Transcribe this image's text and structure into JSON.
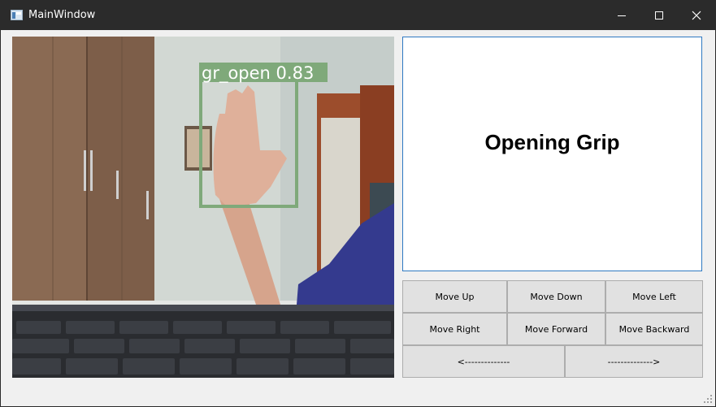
{
  "window": {
    "title": "MainWindow",
    "controls": {
      "minimize_icon": "minimize-icon",
      "maximize_icon": "maximize-icon",
      "close_icon": "close-icon"
    }
  },
  "camera_feed": {
    "detection_label": "gr_open 0.83",
    "detection_box_color": "#7fa97a"
  },
  "status_panel": {
    "text": "Opening Grip",
    "border_color": "#2f79c2"
  },
  "controls": {
    "move_up": "Move Up",
    "move_down": "Move Down",
    "move_left": "Move Left",
    "move_right": "Move Right",
    "move_forward": "Move Forward",
    "move_backward": "Move Backward",
    "prev_arrow": "<--------------",
    "next_arrow": "-------------->"
  }
}
